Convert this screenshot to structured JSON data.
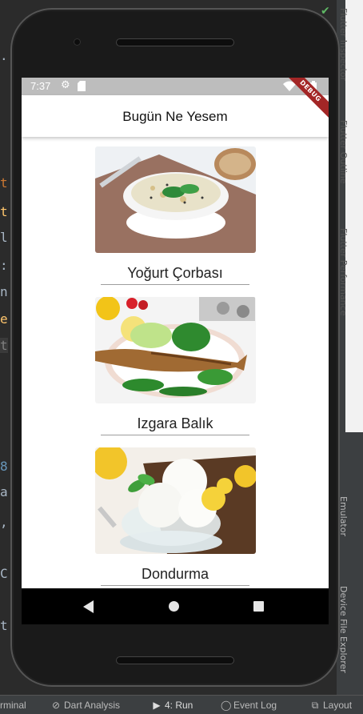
{
  "ide": {
    "gutter_chars": [
      ".",
      "t",
      "t",
      "l",
      ":",
      "n",
      "e",
      "t",
      "8",
      "a",
      ",",
      "C",
      "t"
    ],
    "side_tabs": [
      "Flutter Inspector",
      "Flutter Outline",
      "Flutter Performance",
      "Emulator",
      "Device File Explorer"
    ],
    "bottom_tabs": [
      {
        "label": "rminal",
        "icon": ""
      },
      {
        "label": "Dart Analysis",
        "icon": "dart-analysis-icon"
      },
      {
        "label": "4: Run",
        "icon": "run-icon"
      },
      {
        "label": "Event Log",
        "icon": "event-log-icon"
      },
      {
        "label": "Layout",
        "icon": "layout-inspector-icon"
      }
    ]
  },
  "status_bar": {
    "time": "7:37",
    "icons": [
      "gear-icon",
      "sd-card-icon",
      "wifi-icon",
      "battery-icon"
    ]
  },
  "app_bar": {
    "title": "Bugün Ne Yesem",
    "debug_banner": "DEBUG"
  },
  "foods": [
    {
      "name": "Yoğurt Çorbası",
      "image": "yogurt-soup-image"
    },
    {
      "name": "Izgara Balık",
      "image": "grilled-fish-image"
    },
    {
      "name": "Dondurma",
      "image": "ice-cream-image"
    }
  ],
  "colors": {
    "status_bar_bg": "#bdbdbd",
    "debug_banner": "#a32626",
    "nav_bar_bg": "#000000",
    "ide_bg": "#2b2b2b"
  }
}
